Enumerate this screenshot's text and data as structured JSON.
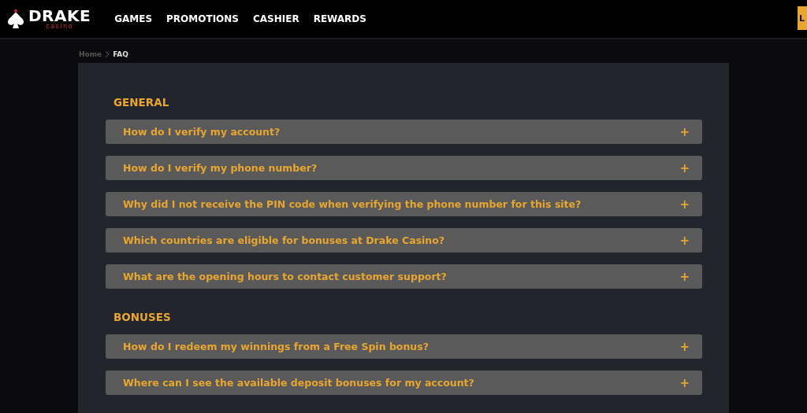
{
  "header": {
    "logo": {
      "name": "DRAKE",
      "tagline": "casino"
    },
    "nav": [
      {
        "label": "GAMES"
      },
      {
        "label": "PROMOTIONS"
      },
      {
        "label": "CASHIER"
      },
      {
        "label": "REWARDS"
      }
    ],
    "action_button": "L"
  },
  "breadcrumb": [
    {
      "label": "Home",
      "current": false
    },
    {
      "label": "FAQ",
      "current": true
    }
  ],
  "sections": [
    {
      "title": "GENERAL",
      "questions": [
        {
          "text": "How do I verify my account?",
          "expanded": false,
          "toggle": "+"
        },
        {
          "text": "How do I verify my phone number?",
          "expanded": false,
          "toggle": "+"
        },
        {
          "text": "Why did I not receive the PIN code when verifying the phone number for this site?",
          "expanded": false,
          "toggle": "+"
        },
        {
          "text": "Which countries are eligible for bonuses at Drake Casino?",
          "expanded": false,
          "toggle": "+"
        },
        {
          "text": "What are the opening hours to contact customer support?",
          "expanded": false,
          "toggle": "+"
        }
      ]
    },
    {
      "title": "BONUSES",
      "questions": [
        {
          "text": "How do I redeem my winnings from a Free Spin bonus?",
          "expanded": false,
          "toggle": "+"
        },
        {
          "text": "Where can I see the available deposit bonuses for my account?",
          "expanded": false,
          "toggle": "+"
        }
      ]
    }
  ]
}
